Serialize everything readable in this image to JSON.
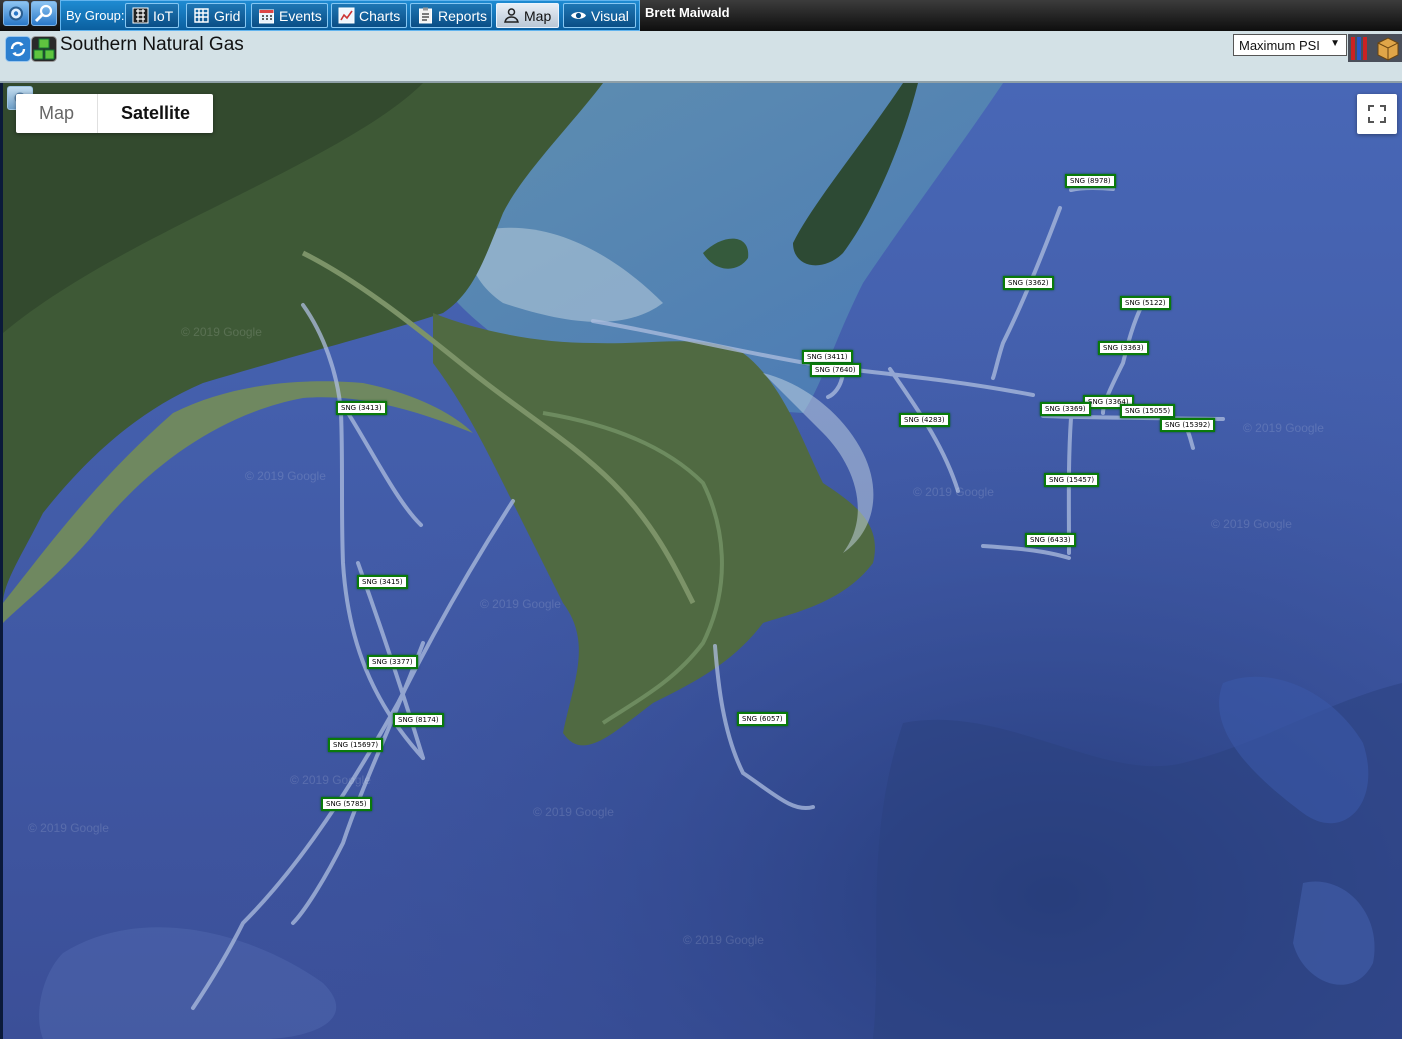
{
  "toolbar": {
    "group_label": "By Group:",
    "buttons": [
      {
        "label": "IoT",
        "icon": "iot-grid-icon"
      },
      {
        "label": "Grid",
        "icon": "grid-icon"
      },
      {
        "label": "Events",
        "icon": "calendar-icon"
      },
      {
        "label": "Charts",
        "icon": "line-chart-icon"
      },
      {
        "label": "Reports",
        "icon": "clipboard-icon"
      },
      {
        "label": "Map",
        "icon": "map-person-icon",
        "active": true
      },
      {
        "label": "Visual",
        "icon": "eye-icon"
      }
    ],
    "user": "Brett Maiwald"
  },
  "titlebar": {
    "title": "Southern Natural Gas",
    "metric_select": "Maximum PSI"
  },
  "map": {
    "type_options": [
      "Map",
      "Satellite"
    ],
    "selected_type": "Satellite",
    "watermark": "© 2019 Google",
    "markers": [
      "SNG (8978)",
      "SNG (3362)",
      "SNG (5122)",
      "SNG (3363)",
      "SNG (3411)",
      "SNG (7640)",
      "SNG (4283)",
      "SNG (3364)",
      "SNG (3369)",
      "SNG (15055)",
      "SNG (15392)",
      "SNG (3413)",
      "SNG (15457)",
      "SNG (6433)",
      "SNG (3415)",
      "SNG (3377)",
      "SNG (8174)",
      "SNG (15697)",
      "SNG (6057)",
      "SNG (5785)"
    ]
  }
}
